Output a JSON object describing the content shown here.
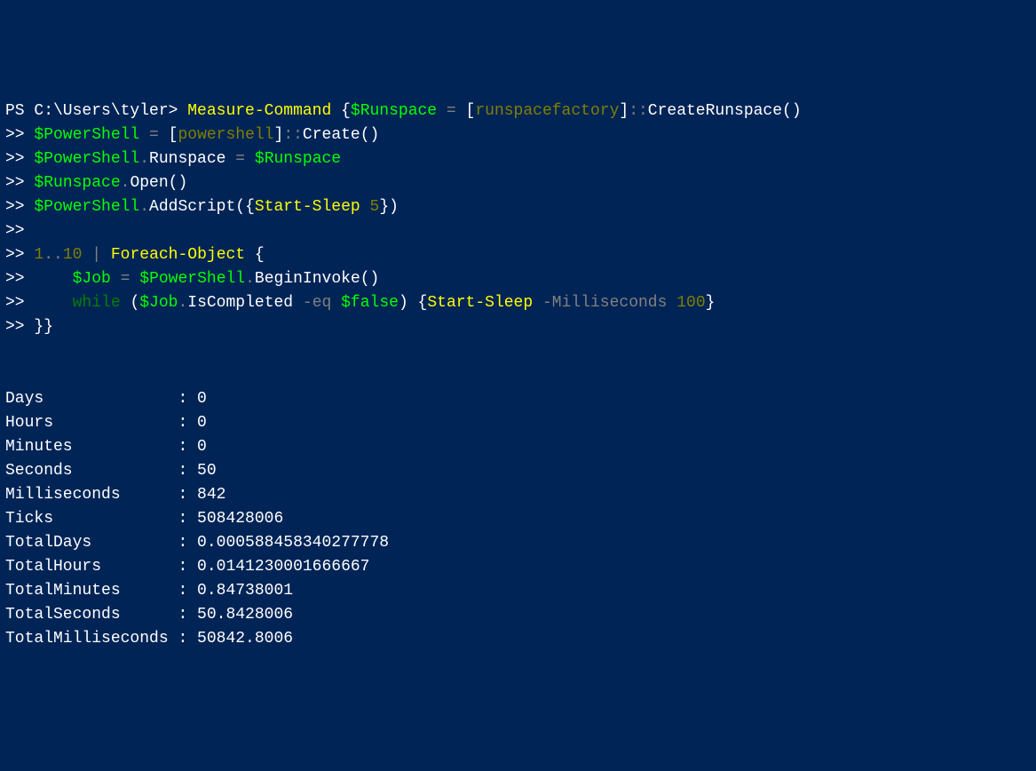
{
  "prompt": {
    "ps": "PS ",
    "path": "C:\\Users\\tyler",
    "gt": "> "
  },
  "cont": ">> ",
  "code": {
    "l1": {
      "cmd": "Measure-Command",
      "sp1": " {",
      "var1": "$Runspace",
      "sp2": " ",
      "eq": "=",
      "sp3": " [",
      "type": "runspacefactory",
      "sp4": "]",
      "op": "::",
      "method": "CreateRunspace()"
    },
    "l2": {
      "var": "$PowerShell",
      "sp1": " ",
      "eq": "=",
      "sp2": " [",
      "type": "powershell",
      "sp3": "]",
      "op": "::",
      "method": "Create()"
    },
    "l3": {
      "var1": "$PowerShell",
      "dot": ".",
      "prop": "Runspace ",
      "eq": "=",
      "sp": " ",
      "var2": "$Runspace"
    },
    "l4": {
      "var": "$Runspace",
      "dot": ".",
      "method": "Open()"
    },
    "l5": {
      "var": "$PowerShell",
      "dot": ".",
      "method": "AddScript({",
      "cmd": "Start-Sleep",
      "sp": " ",
      "num": "5",
      "close": "})"
    },
    "l7": {
      "n1": "1",
      "range": "..",
      "n2": "10",
      "sp1": " ",
      "pipe": "|",
      "sp2": " ",
      "cmd": "Foreach-Object",
      "sp3": " {"
    },
    "l8": {
      "indent": "    ",
      "var1": "$Job",
      "sp1": " ",
      "eq": "=",
      "sp2": " ",
      "var2": "$PowerShell",
      "dot": ".",
      "method": "BeginInvoke()"
    },
    "l9": {
      "indent": "    ",
      "kw": "while",
      "sp1": " (",
      "var": "$Job",
      "dot": ".",
      "prop": "IsCompleted ",
      "op": "-eq",
      "sp2": " ",
      "false": "$false",
      "sp3": ") {",
      "cmd": "Start-Sleep",
      "sp4": " ",
      "param": "-Milliseconds",
      "sp5": " ",
      "num": "100",
      "close": "}"
    },
    "l10": {
      "close": "}}"
    }
  },
  "results": [
    {
      "label": "Days             ",
      "sep": " : ",
      "value": "0"
    },
    {
      "label": "Hours            ",
      "sep": " : ",
      "value": "0"
    },
    {
      "label": "Minutes          ",
      "sep": " : ",
      "value": "0"
    },
    {
      "label": "Seconds          ",
      "sep": " : ",
      "value": "50"
    },
    {
      "label": "Milliseconds     ",
      "sep": " : ",
      "value": "842"
    },
    {
      "label": "Ticks            ",
      "sep": " : ",
      "value": "508428006"
    },
    {
      "label": "TotalDays        ",
      "sep": " : ",
      "value": "0.000588458340277778"
    },
    {
      "label": "TotalHours       ",
      "sep": " : ",
      "value": "0.0141230001666667"
    },
    {
      "label": "TotalMinutes     ",
      "sep": " : ",
      "value": "0.84738001"
    },
    {
      "label": "TotalSeconds     ",
      "sep": " : ",
      "value": "50.8428006"
    },
    {
      "label": "TotalMilliseconds",
      "sep": " : ",
      "value": "50842.8006"
    }
  ]
}
